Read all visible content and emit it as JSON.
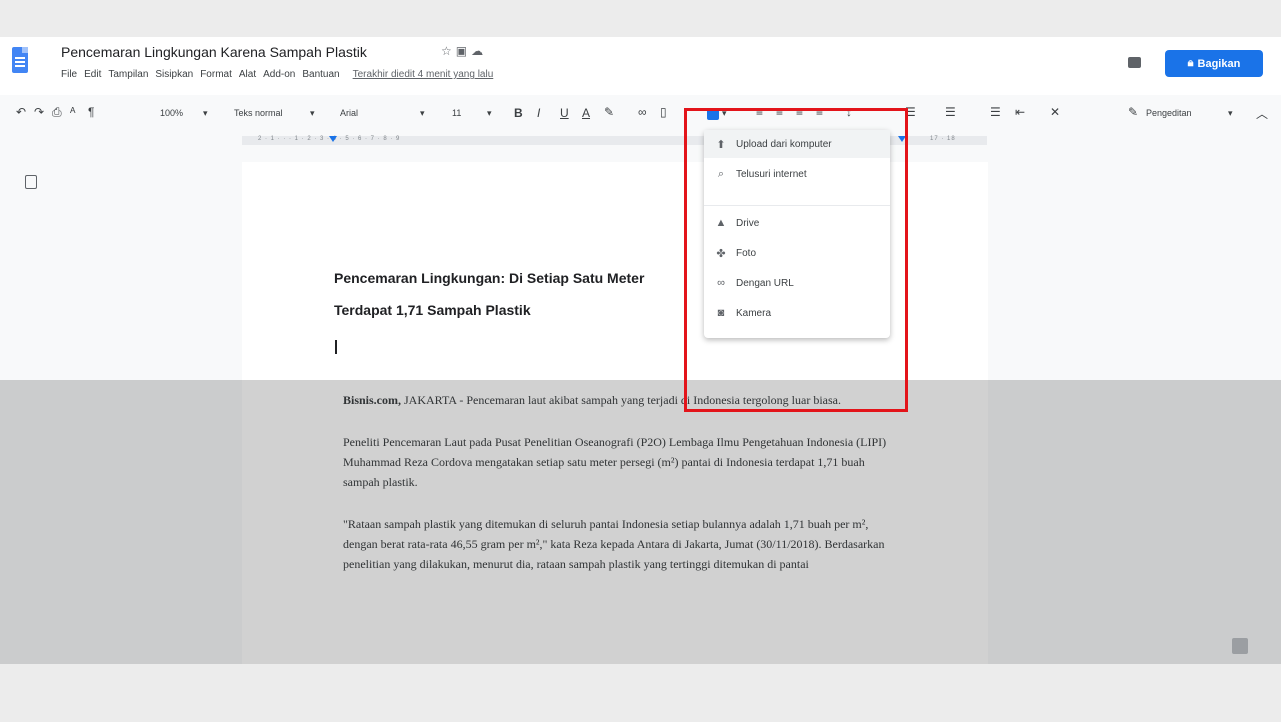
{
  "document": {
    "title": "Pencemaran Lingkungan Karena Sampah Plastik",
    "last_edit": "Terakhir diedit 4 menit yang lalu"
  },
  "menubar": [
    "File",
    "Edit",
    "Tampilan",
    "Sisipkan",
    "Format",
    "Alat",
    "Add-on",
    "Bantuan"
  ],
  "share_button": {
    "label": "Bagikan",
    "color": "#1a73e8"
  },
  "toolbar": {
    "zoom": "100%",
    "style": "Teks normal",
    "font": "Arial",
    "font_size": "11",
    "bold": "B",
    "italic": "I",
    "underline": "U",
    "text_color": "A",
    "editing_mode": "Pengeditan"
  },
  "ruler": {
    "labels": "2 · 1 · · · 1 · 2 · 3 · 4 · 5 · 6 · 7 · 8 · 9",
    "right_labels": "17 · 18"
  },
  "page": {
    "heading_line1": "Pencemaran Lingkungan: Di Setiap Satu Meter",
    "heading_line2": "Terdapat 1,71 Sampah Plastik",
    "p1_source": "Bisnis.com,",
    "p1_rest": " JAKARTA - Pencemaran laut akibat sampah yang terjadi di Indonesia tergolong luar biasa.",
    "p2": "Peneliti Pencemaran Laut pada Pusat Penelitian Oseanografi (P2O) Lembaga Ilmu Pengetahuan Indonesia (LIPI) Muhammad Reza Cordova mengatakan setiap satu meter persegi (m²) pantai di Indonesia terdapat 1,71 buah sampah plastik.",
    "p3": "\"Rataan sampah plastik yang ditemukan di seluruh pantai Indonesia setiap bulannya adalah 1,71 buah per m², dengan berat rata-rata 46,55 gram per m²,\" kata Reza kepada Antara di Jakarta, Jumat (30/11/2018). Berdasarkan penelitian yang dilakukan, menurut dia, rataan sampah plastik yang tertinggi ditemukan di pantai"
  },
  "image_menu": {
    "items": [
      {
        "label": "Upload dari komputer",
        "icon": "upload-icon"
      },
      {
        "label": "Telusuri internet",
        "icon": "search-icon"
      },
      {
        "label": "Drive",
        "icon": "drive-icon"
      },
      {
        "label": "Foto",
        "icon": "photos-icon"
      },
      {
        "label": "Dengan URL",
        "icon": "link-icon"
      },
      {
        "label": "Kamera",
        "icon": "camera-icon"
      }
    ]
  },
  "highlight_color": "#e3141a"
}
